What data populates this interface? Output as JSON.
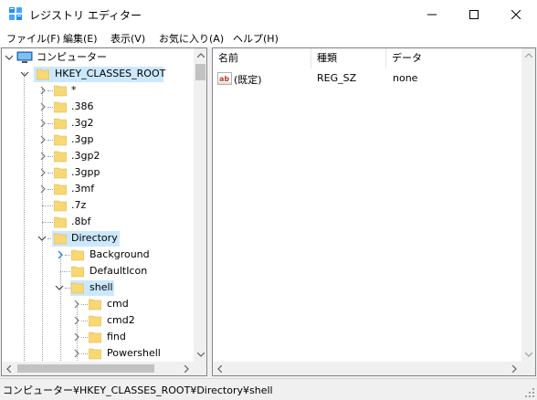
{
  "window": {
    "title": "レジストリ エディター",
    "icon": "regedit-icon"
  },
  "menu": [
    "ファイル(F)",
    "編集(E)",
    "表示(V)",
    "お気に入り(A)",
    "ヘルプ(H)"
  ],
  "tree": {
    "root": "コンピューター",
    "hive": "HKEY_CLASSES_ROOT",
    "hive_children_top": [
      "*",
      ".386",
      ".3g2",
      ".3gp",
      ".3gp2",
      ".3gpp",
      ".3mf",
      ".7z",
      ".8bf"
    ],
    "directory": "Directory",
    "directory_children": [
      "Background",
      "DefaultIcon",
      "shell"
    ],
    "shell_children": [
      "cmd",
      "cmd2",
      "find",
      "Powershell"
    ]
  },
  "list": {
    "columns": [
      "名前",
      "種類",
      "データ"
    ],
    "rows": [
      {
        "name": "(既定)",
        "type": "REG_SZ",
        "data": "none",
        "icon": "string-value-icon"
      }
    ]
  },
  "status": "コンピューター¥HKEY_CLASSES_ROOT¥Directory¥shell",
  "colors": {
    "selection": "#cce8ff",
    "folder": "#f8d775",
    "accent": "#2b88d8"
  }
}
